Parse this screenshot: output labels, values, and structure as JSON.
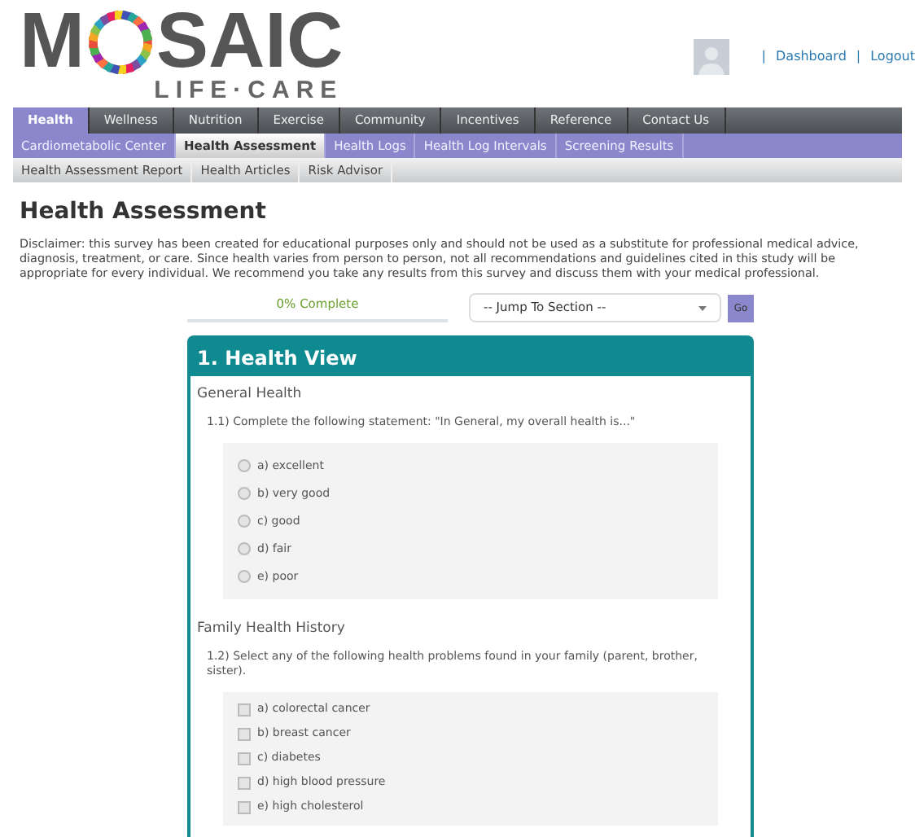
{
  "logo": {
    "before_ring": "M",
    "after_ring": "SAIC",
    "tagline": "LIFE·CARE"
  },
  "user_links": [
    "|",
    "Dashboard",
    "|",
    "Logout"
  ],
  "main_nav": [
    {
      "label": "Health",
      "selected": true
    },
    {
      "label": "Wellness",
      "selected": false
    },
    {
      "label": "Nutrition",
      "selected": false
    },
    {
      "label": "Exercise",
      "selected": false
    },
    {
      "label": "Community",
      "selected": false
    },
    {
      "label": "Incentives",
      "selected": false
    },
    {
      "label": "Reference",
      "selected": false
    },
    {
      "label": "Contact Us",
      "selected": false
    }
  ],
  "sub_nav": [
    {
      "label": "Cardiometabolic Center",
      "selected": false
    },
    {
      "label": "Health Assessment",
      "selected": true
    },
    {
      "label": "Health Logs",
      "selected": false
    },
    {
      "label": "Health Log Intervals",
      "selected": false
    },
    {
      "label": "Screening Results",
      "selected": false
    }
  ],
  "third_nav": [
    "Health Assessment Report",
    "Health Articles",
    "Risk Advisor"
  ],
  "title": "Health Assessment",
  "disclaimer": "Disclaimer: this survey has been created for educational purposes only and should not be used as a substitute for professional medical advice, diagnosis, treatment, or care. Since health varies from person to person, not all recommendations and guidelines cited in this study will be appropriate for every individual. We recommend you take any results from this survey and discuss them with your medical professional.",
  "progress": {
    "label": "0% Complete"
  },
  "jump": {
    "value": "-- Jump To Section --",
    "button": "Go"
  },
  "section": {
    "title": "1. Health View",
    "groups": [
      {
        "heading": "General Health",
        "question": "1.1) Complete the following statement: \"In General, my overall health is...\"",
        "kind": "radio",
        "options": [
          {
            "label": "a) excellent",
            "selected": false
          },
          {
            "label": "b) very good",
            "selected": false
          },
          {
            "label": "c) good",
            "selected": false
          },
          {
            "label": "d) fair",
            "selected": false
          },
          {
            "label": "e) poor",
            "selected": false
          }
        ]
      },
      {
        "heading": "Family Health History",
        "question": "1.2) Select any of the following health problems found in your family (parent, brother, sister).",
        "kind": "checkbox",
        "options": [
          {
            "label": "a) colorectal cancer",
            "selected": false
          },
          {
            "label": "b) breast cancer",
            "selected": false
          },
          {
            "label": "c) diabetes",
            "selected": false
          },
          {
            "label": "d) high blood pressure",
            "selected": false
          },
          {
            "label": "e) high cholesterol",
            "selected": false
          }
        ]
      }
    ]
  }
}
